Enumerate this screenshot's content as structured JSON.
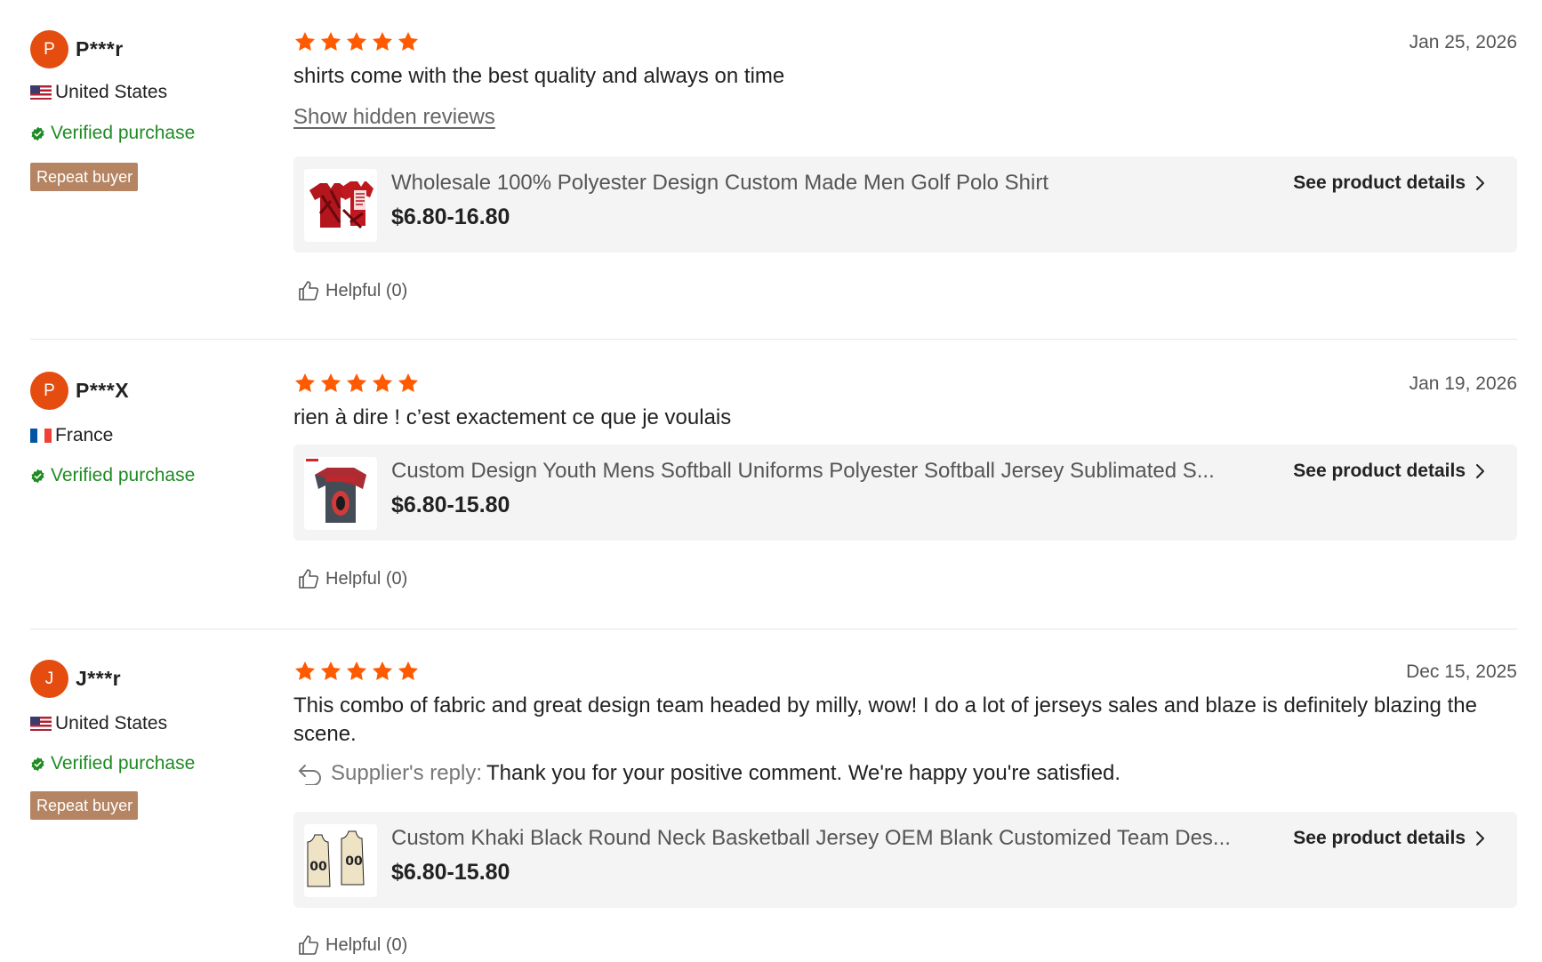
{
  "colors": {
    "accent_orange": "#ff5a00",
    "avatar_bg": "#e44d0f",
    "verified_green": "#1f8b24",
    "repeat_badge_bg": "#b58462",
    "card_bg": "#f4f4f4"
  },
  "reviews": [
    {
      "avatar_initial": "P",
      "user": "P***r",
      "country": "United States",
      "flag_icon": "us-flag-icon",
      "verified": "Verified purchase",
      "badge": "Repeat buyer",
      "rating": 5,
      "date": "Jan 25, 2026",
      "text": "shirts come with the best quality and always on time",
      "hidden_link": "Show hidden reviews",
      "product": {
        "title": "Wholesale 100% Polyester Design Custom Made Men Golf Polo Shirt",
        "price": "$6.80-16.80",
        "details": "See product details"
      },
      "helpful": "Helpful (0)"
    },
    {
      "avatar_initial": "P",
      "user": "P***X",
      "country": "France",
      "flag_icon": "fr-flag-icon",
      "verified": "Verified purchase",
      "rating": 5,
      "date": "Jan 19, 2026",
      "text": "rien à dire ! c’est exactement ce que je voulais",
      "product": {
        "title": "Custom Design Youth Mens Softball Uniforms Polyester Softball Jersey Sublimated S...",
        "price": "$6.80-15.80",
        "details": "See product details"
      },
      "helpful": "Helpful (0)"
    },
    {
      "avatar_initial": "J",
      "user": "J***r",
      "country": "United States",
      "flag_icon": "us-flag-icon",
      "verified": "Verified purchase",
      "badge": "Repeat buyer",
      "rating": 5,
      "date": "Dec 15, 2025",
      "text": "This combo of fabric and great design team headed by milly, wow! I do a lot of jerseys sales and blaze is definitely blazing the scene.",
      "reply_label": "Supplier's reply:",
      "reply_text": "Thank you for your positive comment. We're happy you're satisfied.",
      "product": {
        "title": "Custom Khaki Black Round Neck Basketball Jersey OEM Blank Customized Team Des...",
        "price": "$6.80-15.80",
        "details": "See product details",
        "thumb_text_left": "00",
        "thumb_text_right": "00"
      },
      "helpful": "Helpful (0)"
    }
  ]
}
